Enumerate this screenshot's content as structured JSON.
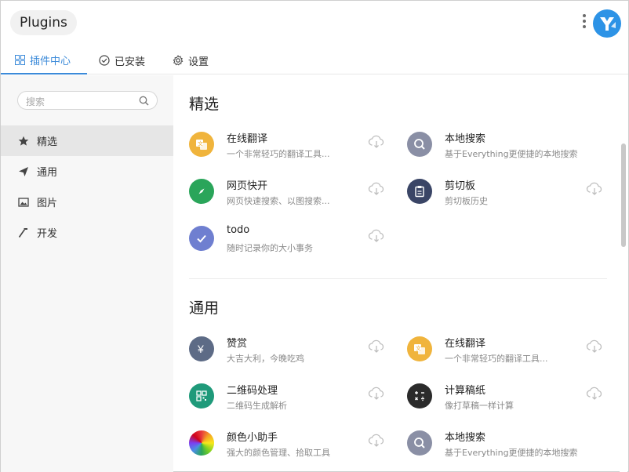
{
  "app": {
    "title": "Plugins"
  },
  "tabs": [
    {
      "label": "插件中心"
    },
    {
      "label": "已安装"
    },
    {
      "label": "设置"
    }
  ],
  "search": {
    "placeholder": "搜索"
  },
  "sidebar": {
    "items": [
      {
        "label": "精选",
        "icon": "star-icon"
      },
      {
        "label": "通用",
        "icon": "send-icon"
      },
      {
        "label": "图片",
        "icon": "image-icon"
      },
      {
        "label": "开发",
        "icon": "hammer-icon"
      }
    ]
  },
  "sections": [
    {
      "title": "精选",
      "plugins": [
        {
          "name": "在线翻译",
          "desc": "一个非常轻巧的翻译工具...",
          "icon": "translate-icon",
          "color": "#f0b43c"
        },
        {
          "name": "本地搜索",
          "desc": "基于Everything更便捷的本地搜索",
          "icon": "search-icon",
          "color": "#8a8fa5"
        },
        {
          "name": "网页快开",
          "desc": "网页快速搜索、以图搜索...",
          "icon": "compass-icon",
          "color": "#2aa55a"
        },
        {
          "name": "剪切板",
          "desc": "剪切板历史",
          "icon": "clipboard-icon",
          "color": "#3a4566"
        },
        {
          "name": "todo",
          "desc": "随时记录你的大小事务",
          "icon": "check-icon",
          "color": "#6f7fd0"
        }
      ]
    },
    {
      "title": "通用",
      "plugins": [
        {
          "name": "赞赏",
          "desc": "大吉大利，今晚吃鸡",
          "icon": "yen-icon",
          "color": "#5d6b86"
        },
        {
          "name": "在线翻译",
          "desc": "一个非常轻巧的翻译工具...",
          "icon": "translate-icon",
          "color": "#f0b43c"
        },
        {
          "name": "二维码处理",
          "desc": "二维码生成解析",
          "icon": "qrcode-icon",
          "color": "#1f9a7a"
        },
        {
          "name": "计算稿纸",
          "desc": "像打草稿一样计算",
          "icon": "calculator-icon",
          "color": "#2b2b2b"
        },
        {
          "name": "颜色小助手",
          "desc": "强大的颜色管理、拾取工具",
          "icon": "color-wheel-icon",
          "color": "#e83b3b"
        },
        {
          "name": "本地搜索",
          "desc": "基于Everything更便捷的本地搜索",
          "icon": "search-icon",
          "color": "#8a8fa5"
        }
      ]
    }
  ],
  "colors": {
    "accent": "#3b8ad9",
    "sidebar_bg": "#f7f7f7",
    "active_item_bg": "#e6e6e6"
  }
}
